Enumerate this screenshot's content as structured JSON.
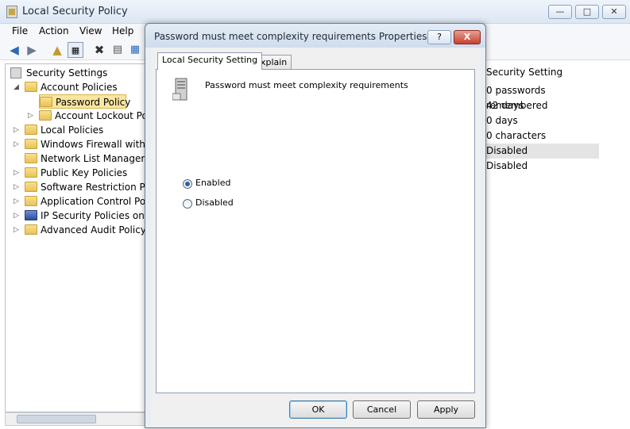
{
  "window": {
    "title": "Local Security Policy",
    "caption_buttons": [
      "minimize-icon",
      "maximize-icon",
      "close-icon"
    ]
  },
  "menu": [
    "File",
    "Action",
    "View",
    "Help"
  ],
  "toolbar_icons": [
    "back-arrow-icon",
    "forward-arrow-icon",
    "up-folder-icon",
    "show-hide-tree-icon",
    "delete-icon",
    "properties-icon",
    "help-icon",
    "export-list-icon"
  ],
  "tree": {
    "root": "Security Settings",
    "items": [
      {
        "label": "Account Policies",
        "expanded": true
      },
      {
        "label": "Password Policy",
        "selected": true
      },
      {
        "label": "Account Lockout Poli"
      },
      {
        "label": "Local Policies"
      },
      {
        "label": "Windows Firewall with Ac"
      },
      {
        "label": "Network List Manager Po"
      },
      {
        "label": "Public Key Policies"
      },
      {
        "label": "Software Restriction Polic"
      },
      {
        "label": "Application Control Polic"
      },
      {
        "label": "IP Security Policies on Lo"
      },
      {
        "label": "Advanced Audit Policy C"
      }
    ]
  },
  "list": {
    "header": "Security Setting",
    "values": [
      "0 passwords remembered",
      "42 days",
      "0 days",
      "0 characters",
      "Disabled",
      "Disabled"
    ]
  },
  "dialog": {
    "title": "Password must meet complexity requirements Properties",
    "help_label": "?",
    "close_label": "X",
    "tabs": [
      "Local Security Setting",
      "Explain"
    ],
    "policy_name": "Password must meet complexity requirements",
    "options": [
      {
        "label": "Enabled",
        "checked": true
      },
      {
        "label": "Disabled",
        "checked": false
      }
    ],
    "buttons": {
      "ok": "OK",
      "cancel": "Cancel",
      "apply": "Apply"
    }
  }
}
